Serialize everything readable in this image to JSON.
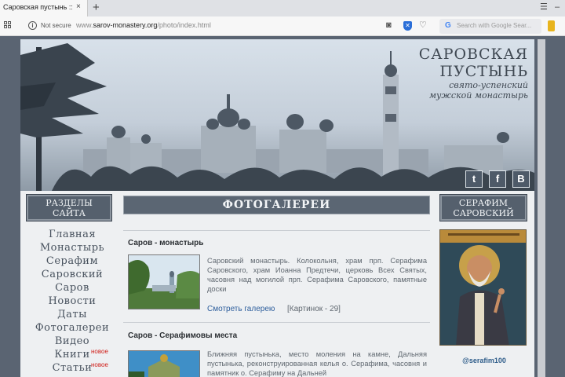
{
  "browser": {
    "tab_title": "Саровская пустынь :: Фот",
    "tab_close": "×",
    "new_tab": "+",
    "not_secure": "Not secure",
    "url_prefix": "www.",
    "url_domain": "sarov-monastery.org",
    "url_path": "/photo/index.html",
    "search_placeholder": "Search with Google Sear..."
  },
  "banner": {
    "title_line1": "САРОВСКАЯ",
    "title_line2": "ПУСТЫНЬ",
    "subtitle_line1": "свято-успенский",
    "subtitle_line2": "мужской монастырь",
    "social": [
      "twitter",
      "facebook",
      "vk"
    ]
  },
  "sidebar": {
    "header_line1": "РАЗДЕЛЫ",
    "header_line2": "САЙТА",
    "items": [
      {
        "label": "Главная"
      },
      {
        "label": "Монастырь"
      },
      {
        "label": "Серафим"
      },
      {
        "label": "Саровский"
      },
      {
        "label": "Саров"
      },
      {
        "label": "Новости"
      },
      {
        "label": "Даты"
      },
      {
        "label": "Фотогалереи"
      },
      {
        "label": "Видео"
      },
      {
        "label": "Книги",
        "badge": "новое"
      },
      {
        "label": "Статьи",
        "badge": "новое"
      }
    ]
  },
  "main": {
    "header": "ФОТОГАЛЕРЕИ",
    "sections": [
      {
        "title": "Саров - монастырь",
        "description": "Саровский монастырь. Колокольня, храм прп. Серафима Саровского, храм Иоанна Предтечи, церковь Всех Святых, часовня над могилой прп. Серафима Саровского, памятные доски",
        "link": "Смотреть галерею",
        "count": "[Картинок - 29]"
      },
      {
        "title": "Саров - Серафимовы места",
        "description": "Ближняя пустынька, место моления на камне, Дальняя пустынька, реконструированная келья о. Серафима, часовня и памятник о. Серафиму на Дальней"
      }
    ]
  },
  "right": {
    "header_line1": "СЕРАФИМ",
    "header_line2": "САРОВСКИЙ",
    "handle": "@serafim100"
  },
  "colors": {
    "accent": "#55606d",
    "link": "#2d5e9c",
    "badge": "#d0201a",
    "background": "#eef0f2"
  }
}
